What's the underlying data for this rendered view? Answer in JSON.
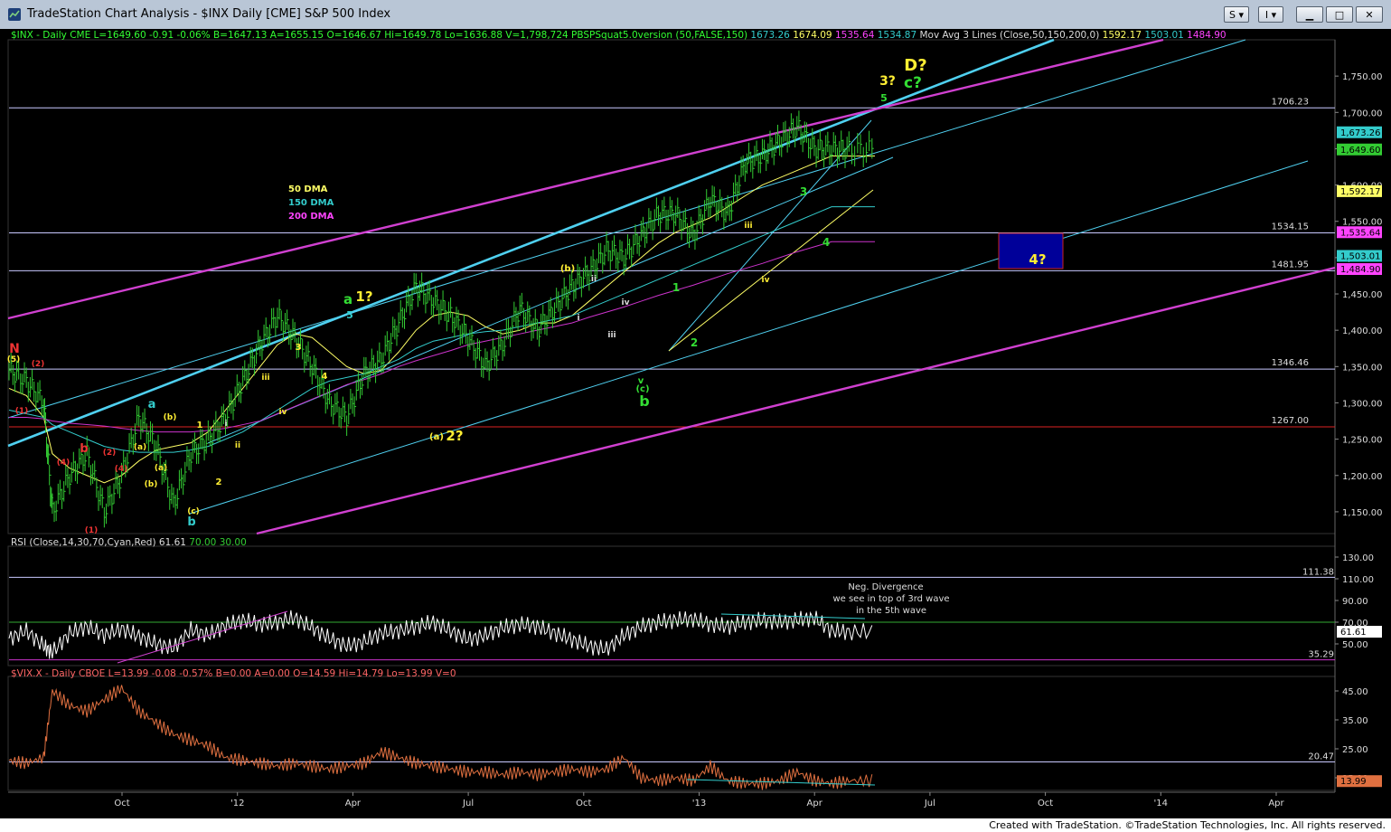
{
  "window": {
    "title": "TradeStation Chart Analysis - $INX Daily [CME] S&P 500 Index",
    "buttons": {
      "s": "S",
      "i": "I"
    }
  },
  "colors": {
    "price": "#33cc33",
    "ma50": "#ffff66",
    "ma150": "#33cccc",
    "ma200": "#cc33cc",
    "hline": "#c8c8ff",
    "channel_cyan": "#4fd0f0",
    "channel_magenta": "#d040d0",
    "rsi": "#ffffff",
    "vix": "#e07040",
    "label_green": "#33dd33",
    "label_yellow": "#ffee33",
    "label_cyan": "#33cccc",
    "label_red": "#ee3333",
    "label_white": "#dddddd",
    "box_fill": "#000099"
  },
  "header": {
    "price_line": {
      "parts": [
        {
          "text": "$INX - Daily  CME  L=1649.60  -0.91  -0.06%  B=1647.13  A=1655.15  O=1646.67  Hi=1649.78  Lo=1636.88  V=1,798,724  PBSPSquat5.0version (50,FALSE,150)",
          "color": "#33ff33"
        },
        {
          "text": "1673.26",
          "color": "#33cccc"
        },
        {
          "text": "1674.09",
          "color": "#ffff66"
        },
        {
          "text": "1535.64",
          "color": "#ff44ff"
        },
        {
          "text": "1534.87",
          "color": "#33cccc"
        },
        {
          "text": "Mov Avg 3 Lines (Close,50,150,200,0)",
          "color": "#dddddd"
        },
        {
          "text": "1592.17",
          "color": "#ffff66"
        },
        {
          "text": "1503.01",
          "color": "#33cccc"
        },
        {
          "text": "1484.90",
          "color": "#ff44ff"
        }
      ]
    },
    "rsi_line": {
      "parts": [
        {
          "text": "RSI (Close,14,30,70,Cyan,Red)",
          "color": "#dddddd"
        },
        {
          "text": "61.61",
          "color": "#dddddd"
        },
        {
          "text": "70.00",
          "color": "#33cc33"
        },
        {
          "text": "30.00",
          "color": "#33cc33"
        }
      ]
    },
    "vix_line": {
      "parts": [
        {
          "text": "$VIX.X - Daily  CBOE  L=13.99  -0.08  -0.57%  B=0.00  A=0.00  O=14.59  Hi=14.79  Lo=13.99  V=0",
          "color": "#ff6666"
        }
      ]
    }
  },
  "chart_data": {
    "type": "line",
    "title": "$INX Daily [CME] S&P 500 Index",
    "x_tick_labels": [
      "Oct",
      "'12",
      "Apr",
      "Jul",
      "Oct",
      "'13",
      "Apr",
      "Jul",
      "Oct",
      "'14",
      "Apr"
    ],
    "price_panel": {
      "y_ticks": [
        1150,
        1200,
        1250,
        1300,
        1350,
        1400,
        1450,
        1500,
        1550,
        1600,
        1650,
        1700,
        1750
      ],
      "y_tick_labels": [
        "1,150.00",
        "1,200.00",
        "1,250.00",
        "1,300.00",
        "1,350.00",
        "1,400.00",
        "1,450.00",
        "1,500.00",
        "1,550.00",
        "1,600.00",
        "1,650.00",
        "1,700.00",
        "1,750.00"
      ],
      "ylim": [
        1120,
        1800
      ],
      "horizontal_levels": [
        {
          "value": 1706.23,
          "label": "1706.23"
        },
        {
          "value": 1534.15,
          "label": "1534.15"
        },
        {
          "value": 1481.95,
          "label": "1481.95"
        },
        {
          "value": 1346.46,
          "label": "1346.46"
        },
        {
          "value": 1267.0,
          "label": "1267.00",
          "color": "red"
        }
      ],
      "price_badges": [
        {
          "value": 1673.26,
          "label": "1,673.26",
          "bg": "#33cccc",
          "fg": "#000000"
        },
        {
          "value": 1649.6,
          "label": "1,649.60",
          "bg": "#33cc33",
          "fg": "#000000"
        },
        {
          "value": 1592.17,
          "label": "1,592.17",
          "bg": "#ffff66",
          "fg": "#000000"
        },
        {
          "value": 1535.64,
          "label": "1,535.64",
          "bg": "#ff44ff",
          "fg": "#000000"
        },
        {
          "value": 1503.01,
          "label": "1,503.01",
          "bg": "#33cccc",
          "fg": "#000000"
        },
        {
          "value": 1484.9,
          "label": "1,484.90",
          "bg": "#ff44ff",
          "fg": "#000000"
        }
      ],
      "series": [
        {
          "name": "$INX",
          "x": [
            0.0,
            0.02,
            0.04,
            0.05,
            0.07,
            0.09,
            0.11,
            0.13,
            0.15,
            0.17,
            0.19,
            0.21,
            0.23,
            0.25,
            0.27,
            0.29,
            0.31,
            0.33,
            0.35,
            0.37,
            0.39,
            0.41,
            0.43,
            0.45,
            0.47,
            0.49,
            0.51,
            0.53,
            0.55,
            0.57,
            0.59,
            0.61,
            0.63,
            0.65,
            0.67,
            0.69,
            0.71,
            0.73,
            0.75,
            0.77,
            0.79,
            0.81,
            0.83,
            0.85,
            0.87,
            0.89,
            0.91,
            0.93,
            0.95,
            0.97,
            1.0
          ],
          "values": [
            1345,
            1330,
            1300,
            1150,
            1200,
            1230,
            1150,
            1200,
            1280,
            1240,
            1160,
            1230,
            1250,
            1280,
            1330,
            1380,
            1420,
            1390,
            1350,
            1300,
            1280,
            1340,
            1360,
            1410,
            1460,
            1440,
            1420,
            1390,
            1350,
            1380,
            1430,
            1400,
            1430,
            1460,
            1480,
            1510,
            1500,
            1530,
            1560,
            1560,
            1530,
            1580,
            1560,
            1630,
            1640,
            1660,
            1680,
            1650,
            1649,
            1649,
            1649
          ]
        },
        {
          "name": "50 DMA",
          "values": [
            1320,
            1310,
            1280,
            1230,
            1210,
            1200,
            1190,
            1200,
            1220,
            1235,
            1240,
            1245,
            1260,
            1290,
            1320,
            1350,
            1380,
            1395,
            1390,
            1370,
            1350,
            1340,
            1345,
            1370,
            1400,
            1420,
            1425,
            1420,
            1405,
            1395,
            1400,
            1410,
            1410,
            1420,
            1440,
            1460,
            1480,
            1500,
            1520,
            1535,
            1545,
            1555,
            1570,
            1585,
            1600,
            1610,
            1620,
            1630,
            1640,
            1640,
            1640
          ]
        },
        {
          "name": "150 DMA",
          "values": [
            1290,
            1285,
            1280,
            1270,
            1260,
            1250,
            1240,
            1235,
            1232,
            1232,
            1232,
            1235,
            1240,
            1250,
            1260,
            1275,
            1290,
            1305,
            1320,
            1330,
            1335,
            1340,
            1350,
            1360,
            1375,
            1385,
            1390,
            1395,
            1398,
            1400,
            1405,
            1410,
            1415,
            1420,
            1430,
            1440,
            1450,
            1460,
            1470,
            1480,
            1490,
            1500,
            1510,
            1520,
            1530,
            1540,
            1550,
            1560,
            1570,
            1570,
            1570
          ]
        },
        {
          "name": "200 DMA",
          "values": [
            1280,
            1280,
            1278,
            1275,
            1272,
            1270,
            1268,
            1265,
            1262,
            1260,
            1260,
            1260,
            1262,
            1265,
            1270,
            1275,
            1285,
            1295,
            1305,
            1315,
            1325,
            1332,
            1340,
            1350,
            1358,
            1365,
            1372,
            1380,
            1385,
            1390,
            1395,
            1400,
            1405,
            1410,
            1418,
            1425,
            1432,
            1440,
            1448,
            1455,
            1462,
            1470,
            1478,
            1485,
            1492,
            1500,
            1508,
            1515,
            1522,
            1522,
            1522
          ]
        }
      ],
      "ma_legend": [
        "50 DMA",
        "150 DMA",
        "200 DMA"
      ],
      "target_box": {
        "label": "4?",
        "y_top": 1534.15,
        "y_bottom": 1481.95
      }
    },
    "rsi_panel": {
      "y_ticks": [
        50,
        70,
        90,
        110,
        130
      ],
      "y_tick_labels": [
        "50.00",
        "70.00",
        "90.00",
        "110.00",
        "130.00"
      ],
      "ylim": [
        30,
        140
      ],
      "levels": [
        {
          "value": 111.38,
          "label": "111.38"
        },
        {
          "value": 35.29,
          "label": "35.29"
        }
      ],
      "current": {
        "value": 61.61,
        "label": "61.61"
      },
      "annotation": [
        "Neg. Divergence",
        "we see in top of 3rd wave",
        "in the 5th wave"
      ],
      "values": [
        55,
        62,
        48,
        42,
        60,
        66,
        58,
        64,
        57,
        50,
        46,
        63,
        58,
        67,
        72,
        68,
        70,
        74,
        65,
        55,
        48,
        52,
        60,
        62,
        66,
        70,
        62,
        54,
        58,
        65,
        68,
        66,
        60,
        54,
        48,
        45,
        58,
        66,
        70,
        72,
        73,
        68,
        66,
        70,
        72,
        70,
        72,
        74,
        62,
        61,
        61
      ]
    },
    "vix_panel": {
      "y_ticks": [
        15,
        25,
        35,
        45
      ],
      "y_tick_labels": [
        "15.00",
        "25.00",
        "35.00",
        "45.00"
      ],
      "ylim": [
        10,
        50
      ],
      "levels": [
        {
          "value": 20.47,
          "label": "20.47"
        }
      ],
      "current": {
        "value": 13.99,
        "label": "13.99"
      },
      "values": [
        21,
        20,
        22,
        45,
        40,
        38,
        42,
        46,
        38,
        34,
        30,
        28,
        26,
        22,
        21,
        20,
        19,
        20,
        19,
        18,
        19,
        20,
        24,
        22,
        20,
        19,
        18,
        17,
        17,
        16,
        17,
        16,
        17,
        18,
        17,
        18,
        22,
        15,
        14,
        15,
        14,
        19,
        14,
        13,
        13,
        14,
        17,
        14,
        13,
        14,
        14
      ]
    },
    "wave_labels": [
      {
        "text": "D?",
        "x": 1013,
        "y": 78,
        "color": "#ffee33",
        "size": 18
      },
      {
        "text": "c?",
        "x": 1010,
        "y": 97,
        "color": "#33dd33",
        "size": 17
      },
      {
        "text": "3?",
        "x": 982,
        "y": 94,
        "color": "#ffee33",
        "size": 14
      },
      {
        "text": "5",
        "x": 978,
        "y": 112,
        "color": "#33dd33",
        "size": 11
      },
      {
        "text": "a",
        "x": 385,
        "y": 336,
        "color": "#33dd33",
        "size": 15
      },
      {
        "text": "1?",
        "x": 403,
        "y": 333,
        "color": "#ffee33",
        "size": 15
      },
      {
        "text": "5",
        "x": 387,
        "y": 352,
        "color": "#33cccc",
        "size": 11
      },
      {
        "text": "(b)",
        "x": 628,
        "y": 300,
        "color": "#ffee33",
        "size": 10
      },
      {
        "text": "ii",
        "x": 657,
        "y": 311,
        "color": "#dddddd",
        "size": 9
      },
      {
        "text": "i",
        "x": 640,
        "y": 354,
        "color": "#dddddd",
        "size": 9
      },
      {
        "text": "iv",
        "x": 692,
        "y": 337,
        "color": "#dddddd",
        "size": 9
      },
      {
        "text": "iii",
        "x": 677,
        "y": 373,
        "color": "#dddddd",
        "size": 9
      },
      {
        "text": "1",
        "x": 748,
        "y": 322,
        "color": "#33dd33",
        "size": 12
      },
      {
        "text": "2",
        "x": 768,
        "y": 383,
        "color": "#33dd33",
        "size": 12
      },
      {
        "text": "3",
        "x": 889,
        "y": 216,
        "color": "#33dd33",
        "size": 12
      },
      {
        "text": "4",
        "x": 914,
        "y": 272,
        "color": "#33dd33",
        "size": 12
      },
      {
        "text": "iii",
        "x": 828,
        "y": 252,
        "color": "#ffee33",
        "size": 9
      },
      {
        "text": "iv",
        "x": 847,
        "y": 312,
        "color": "#ffee33",
        "size": 9
      },
      {
        "text": "v",
        "x": 709,
        "y": 424,
        "color": "#33dd33",
        "size": 10
      },
      {
        "text": "(c)",
        "x": 711,
        "y": 433,
        "color": "#33dd33",
        "size": 10
      },
      {
        "text": "b",
        "x": 713,
        "y": 449,
        "color": "#33dd33",
        "size": 16
      },
      {
        "text": "(a)",
        "x": 483,
        "y": 486,
        "color": "#ffee33",
        "size": 10
      },
      {
        "text": "2?",
        "x": 503,
        "y": 487,
        "color": "#ffee33",
        "size": 15
      },
      {
        "text": "3",
        "x": 330,
        "y": 387,
        "color": "#ffee33",
        "size": 10
      },
      {
        "text": "4",
        "x": 359,
        "y": 419,
        "color": "#ffee33",
        "size": 10
      },
      {
        "text": "iii",
        "x": 294,
        "y": 420,
        "color": "#ffee33",
        "size": 9
      },
      {
        "text": "iv",
        "x": 313,
        "y": 458,
        "color": "#ffee33",
        "size": 9
      },
      {
        "text": "1",
        "x": 221,
        "y": 473,
        "color": "#ffee33",
        "size": 10
      },
      {
        "text": "2",
        "x": 242,
        "y": 536,
        "color": "#ffee33",
        "size": 10
      },
      {
        "text": "i",
        "x": 250,
        "y": 471,
        "color": "#dddddd",
        "size": 9
      },
      {
        "text": "ii",
        "x": 263,
        "y": 495,
        "color": "#ffee33",
        "size": 9
      },
      {
        "text": "a",
        "x": 168,
        "y": 451,
        "color": "#33cccc",
        "size": 13
      },
      {
        "text": "(b)",
        "x": 188,
        "y": 464,
        "color": "#ffee33",
        "size": 9
      },
      {
        "text": "(a)",
        "x": 155,
        "y": 497,
        "color": "#ffee33",
        "size": 9
      },
      {
        "text": "(a)",
        "x": 178,
        "y": 520,
        "color": "#ffee33",
        "size": 9
      },
      {
        "text": "(b)",
        "x": 167,
        "y": 538,
        "color": "#ffee33",
        "size": 9
      },
      {
        "text": "(c)",
        "x": 214,
        "y": 568,
        "color": "#ffee33",
        "size": 9
      },
      {
        "text": "b",
        "x": 212,
        "y": 581,
        "color": "#33cccc",
        "size": 13
      },
      {
        "text": "N",
        "x": 16,
        "y": 390,
        "color": "#ee3333",
        "size": 14
      },
      {
        "text": "(5)",
        "x": 15,
        "y": 400,
        "color": "#ffee33",
        "size": 9
      },
      {
        "text": "(2)",
        "x": 42,
        "y": 405,
        "color": "#ee3333",
        "size": 9
      },
      {
        "text": "(1)",
        "x": 24,
        "y": 457,
        "color": "#ee3333",
        "size": 9
      },
      {
        "text": "b",
        "x": 93,
        "y": 500,
        "color": "#ee3333",
        "size": 13
      },
      {
        "text": "(2)",
        "x": 121,
        "y": 503,
        "color": "#ee3333",
        "size": 9
      },
      {
        "text": "(4)",
        "x": 70,
        "y": 514,
        "color": "#ee3333",
        "size": 9
      },
      {
        "text": "(4)",
        "x": 134,
        "y": 521,
        "color": "#ee3333",
        "size": 9
      },
      {
        "text": "(1)",
        "x": 101,
        "y": 589,
        "color": "#ee3333",
        "size": 9
      }
    ]
  },
  "footer": {
    "text": "Created with TradeStation. ©TradeStation Technologies, Inc. All rights reserved."
  }
}
